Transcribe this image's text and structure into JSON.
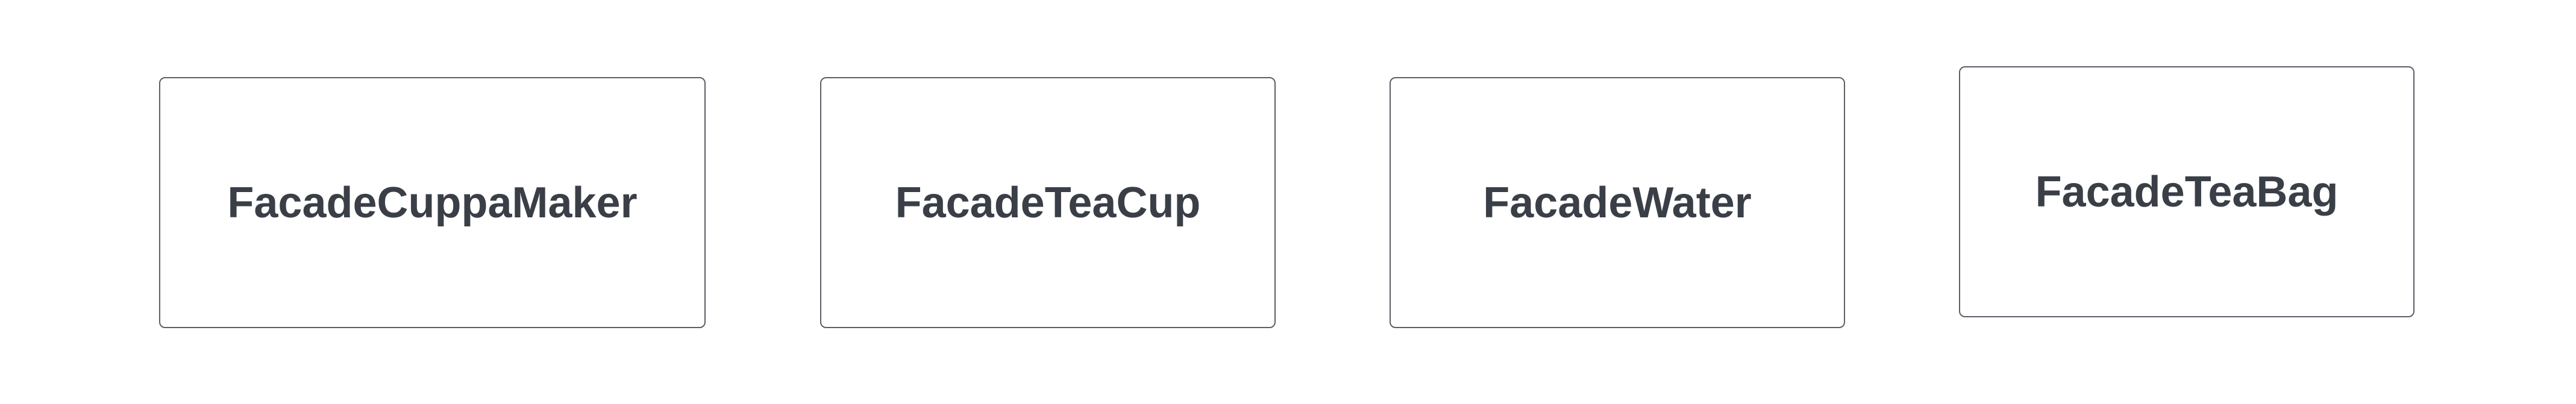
{
  "diagram": {
    "nodes": [
      {
        "label": "FacadeCuppaMaker"
      },
      {
        "label": "FacadeTeaCup"
      },
      {
        "label": "FacadeWater"
      },
      {
        "label": "FacadeTeaBag"
      }
    ]
  }
}
